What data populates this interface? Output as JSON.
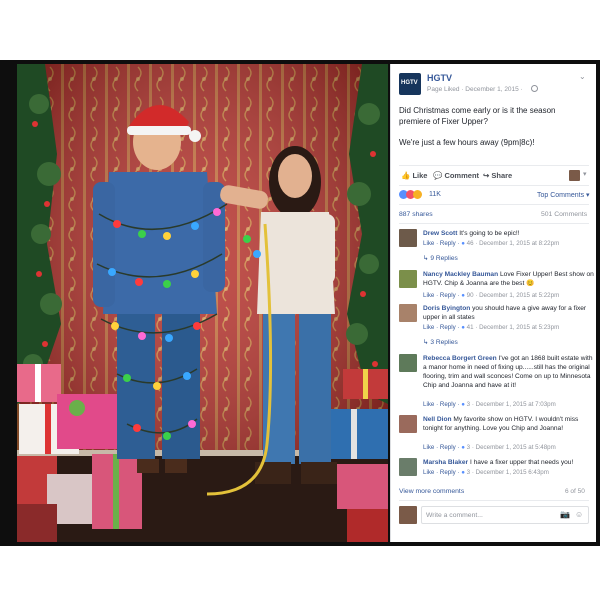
{
  "post": {
    "page_name": "HGTV",
    "page_logo": "HGTV",
    "meta": "Page Liked · December 1, 2015 ·",
    "text_line1": "Did Christmas come early or is it the season premiere of Fixer Upper?",
    "text_line2": "We're just a few hours away (9pm|8c)!"
  },
  "actions": {
    "like": "Like",
    "comment": "Comment",
    "share": "Share"
  },
  "reactions": {
    "count": "11K",
    "sort": "Top Comments ▾"
  },
  "stats": {
    "shares": "887 shares",
    "comments": "501 Comments"
  },
  "comments": [
    {
      "name": "Drew Scott",
      "text": "It's going to be epic!!",
      "reply": "Like · Reply ·",
      "likes": "46",
      "time": "· December 1, 2015 at 8:22pm",
      "replies": "9 Replies",
      "avatar": "#6d5a4a"
    },
    {
      "name": "Nancy Mackley Bauman",
      "text": "Love Fixer Upper! Best show on HGTV. Chip & Joanna are the best",
      "reply": "Like · Reply ·",
      "likes": "90",
      "time": "· December 1, 2015 at 5:22pm",
      "avatar": "#7b8f4a"
    },
    {
      "name": "Doris Byington",
      "text": "you should have a give away for a fixer upper in all states",
      "reply": "Like · Reply ·",
      "likes": "41",
      "time": "· December 1, 2015 at 5:23pm",
      "replies": "3 Replies",
      "avatar": "#a8826a"
    },
    {
      "name": "Rebecca Borgert Green",
      "text": "I've got an 1868 built estate with a manor home in need of fixing up......still has the original flooring, trim and wall sconces! Come on up to Minnesota Chip and Joanna and have at it!",
      "reply": "Like · Reply ·",
      "likes": "3",
      "time": "· December 1, 2015 at 7:03pm",
      "avatar": "#5e7a5a"
    },
    {
      "name": "Nell Dion",
      "text": "My favorite show on HGTV. I wouldn't miss tonight for anything. Love you Chip and Joanna!",
      "reply": "Like · Reply ·",
      "likes": "3",
      "time": "· December 1, 2015 at 5:48pm",
      "avatar": "#9a6a5c"
    },
    {
      "name": "Marsha Blaker",
      "text": "I have a fixer upper that needs you!",
      "reply": "Like · Reply ·",
      "likes": "3",
      "time": "· December 1, 2015 6:43pm",
      "avatar": "#6a7d6a"
    }
  ],
  "view_more": "View more comments",
  "count_of": "6 of 50",
  "write_placeholder": "Write a comment..."
}
